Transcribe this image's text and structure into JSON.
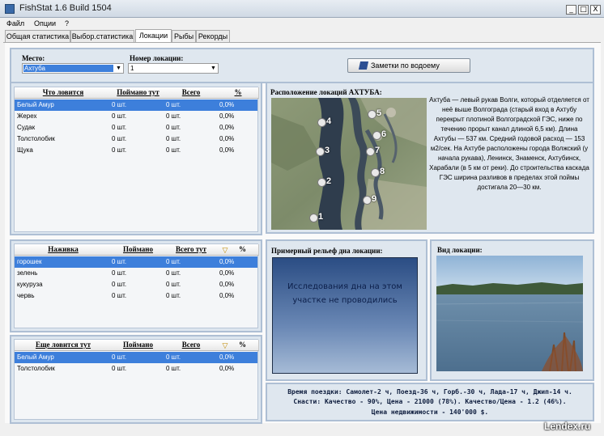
{
  "window": {
    "title": "FishStat 1.6 Build 1504",
    "min": "_",
    "max": "□",
    "close": "X"
  },
  "menu": [
    "Файл",
    "Опции",
    "?"
  ],
  "tabs": [
    "Общая статистика",
    "Выбор.статистика",
    "Локации",
    "Рыбы",
    "Рекорды"
  ],
  "controls": {
    "place_label": "Место:",
    "place_value": "Ахтуба",
    "location_label": "Номер локации:",
    "location_value": "1",
    "notes_button": "Заметки по водоему"
  },
  "catch_table": {
    "headers": [
      "Что ловится",
      "Поймано тут",
      "Всего",
      "%"
    ],
    "rows": [
      [
        "Белый Амур",
        "0 шт.",
        "0 шт.",
        "0,0%"
      ],
      [
        "Жерех",
        "0 шт.",
        "0 шт.",
        "0,0%"
      ],
      [
        "Судак",
        "0 шт.",
        "0 шт.",
        "0,0%"
      ],
      [
        "Толстолобик",
        "0 шт.",
        "0 шт.",
        "0,0%"
      ],
      [
        "Щука",
        "0 шт.",
        "0 шт.",
        "0,0%"
      ]
    ]
  },
  "bait_table": {
    "headers": [
      "Наживка",
      "Поймано",
      "Всего тут",
      "▽",
      "%"
    ],
    "rows": [
      [
        "горошек",
        "0 шт.",
        "0 шт.",
        "0,0%"
      ],
      [
        "зелень",
        "0 шт.",
        "0 шт.",
        "0,0%"
      ],
      [
        "кукуруза",
        "0 шт.",
        "0 шт.",
        "0,0%"
      ],
      [
        "червь",
        "0 шт.",
        "0 шт.",
        "0,0%"
      ]
    ]
  },
  "more_table": {
    "headers": [
      "Еще ловится тут",
      "Поймано",
      "Всего",
      "▽",
      "%"
    ],
    "rows": [
      [
        "Белый Амур",
        "0 шт.",
        "0 шт.",
        "0,0%"
      ],
      [
        "Толстолобик",
        "0 шт.",
        "0 шт.",
        "0,0%"
      ]
    ]
  },
  "map": {
    "title": "Расположение локаций АХТУБА:",
    "markers": [
      "1",
      "2",
      "3",
      "4",
      "5",
      "6",
      "7",
      "8",
      "9"
    ],
    "description": "Ахтуба — левый рукав Волги, который отделяется от неё выше Волгограда (старый вход в Ахтубу перекрыт плотиной Волгоградской ГЭС, ниже по течению прорыт канал длиной 6,5 км). Длина Ахтубы — 537 км. Средний годовой расход — 153 м2/сек. На Ахтубе расположены города Волжский (у начала рукава), Ленинск, Знаменск, Ахтубинск, Харабали (в 5 км от реки). До строительства каскада ГЭС ширина разливов в пределах этой поймы достигала 20—30 км."
  },
  "relief": {
    "title": "Примерный рельеф дна локации:",
    "text": "Исследования дна на этом участке не проводились"
  },
  "view": {
    "title": "Вид локации:"
  },
  "info": {
    "line1": "Время поездки: Самолет-2 ч, Поезд-36 ч, Горб.-30 ч, Лада-17 ч, Джип-14 ч.",
    "line2": "Снасти: Качество - 90%, Цена - 21000 (78%). Качество/Цена - 1.2 (46%).",
    "line3": "Цена недвижимости - 140'000 $."
  },
  "watermark": "Lendex.ru"
}
